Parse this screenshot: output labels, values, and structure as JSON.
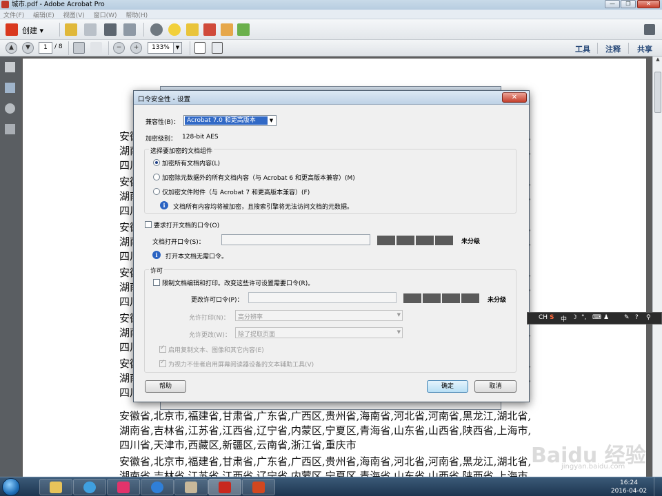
{
  "window": {
    "title": "城市.pdf - Adobe Acrobat Pro"
  },
  "menu": [
    "文件(F)",
    "编辑(E)",
    "视图(V)",
    "窗口(W)",
    "帮助(H)"
  ],
  "toolbar": {
    "create_label": "创建 ▾"
  },
  "navbar": {
    "page_current": "1",
    "page_total": "/ 8",
    "zoom": "133%",
    "tools": "工具",
    "comment": "注释",
    "share": "共享"
  },
  "document": {
    "lines": [
      "安徽省,北京市,福建省,甘肃省,广东省,广西区,贵州省,海南省,河北省,河南省,黑龙江,湖北省,",
      "湖南省,吉林省,江苏省,江西省,辽宁省,内蒙区,宁夏区,青海省,山东省,山西省,陕西省,上海市,",
      "四川省,天津市,西藏区,新疆区,云南省,浙江省,重庆市"
    ]
  },
  "dialog": {
    "title": "口令安全性 - 设置",
    "close": "✕",
    "compat_label": "兼容性(B)：",
    "compat_value": "Acrobat 7.0 和更高版本",
    "enc_level_label": "加密级别：",
    "enc_level_value": "128-bit AES",
    "group_title": "选择要加密的文档组件",
    "radio_all": "加密所有文档内容(L)",
    "radio_except_meta": "加密除元数据外的所有文档内容（与 Acrobat 6 和更高版本兼容）(M)",
    "radio_attach": "仅加密文件附件（与 Acrobat 7 和更高版本兼容）(F)",
    "info_encrypt": "文档所有内容均将被加密，且搜索引擎将无法访问文档的元数据。",
    "require_open_pw": "要求打开文档的口令(O)",
    "open_pw_label": "文档打开口令(S)：",
    "open_pw_strength": "未分级",
    "info_no_pw": "打开本文档无需口令。",
    "permissions_title": "许可",
    "restrict_label": "限制文档编辑和打印。改变这些许可设置需要口令(R)。",
    "change_pw_label": "更改许可口令(P)：",
    "change_pw_strength": "未分级",
    "print_allowed_label": "允许打印(N)：",
    "print_allowed_value": "高分辨率",
    "changes_allowed_label": "允许更改(W)：",
    "changes_allowed_value": "除了提取页面",
    "enable_copy": "启用复制文本、图像和其它内容(E)",
    "enable_access": "为视力不佳者启用屏幕阅读器设备的文本辅助工具(V)",
    "help_btn": "帮助",
    "ok_btn": "确定",
    "cancel_btn": "取消"
  },
  "ime": {
    "items": [
      "CH",
      "S",
      "中",
      "☽",
      "°,",
      "⌨",
      "♟",
      "✎",
      "?",
      "⚲"
    ]
  },
  "watermark": {
    "text": "Baidu 经验",
    "sub": "jingyan.baidu.com"
  },
  "taskbar": {
    "time": "16:24",
    "date": "2016-04-02"
  }
}
